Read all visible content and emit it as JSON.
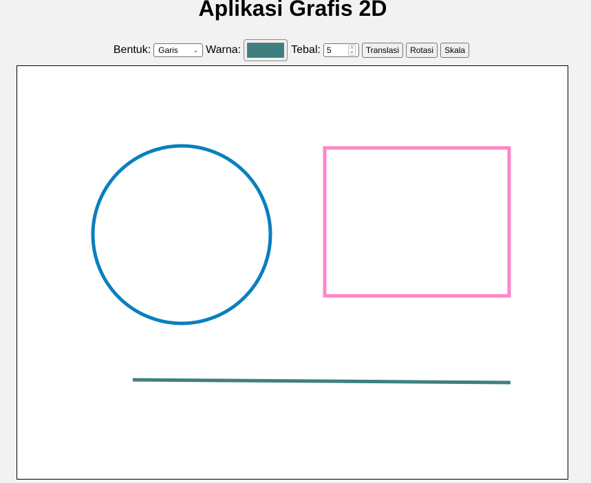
{
  "app": {
    "title": "Aplikasi Grafis 2D"
  },
  "toolbar": {
    "shape_label": "Bentuk:",
    "shape_value": "Garis",
    "color_label": "Warna:",
    "color_value": "#3f7f7f",
    "thickness_label": "Tebal:",
    "thickness_value": "5",
    "translate_label": "Translasi",
    "rotate_label": "Rotasi",
    "scale_label": "Skala"
  },
  "canvas": {
    "shapes": [
      {
        "type": "circle",
        "color": "#0a7fbe"
      },
      {
        "type": "rectangle",
        "color": "#ff85c8"
      },
      {
        "type": "line",
        "color": "#3f7f7f"
      }
    ]
  }
}
